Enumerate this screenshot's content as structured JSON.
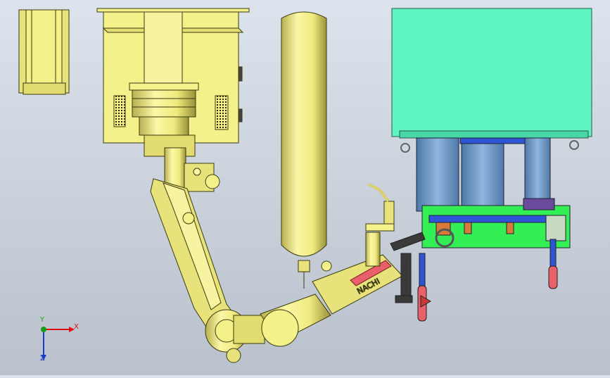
{
  "viewport": {
    "background_top": "#dde3ec",
    "background_bottom": "#b9c1cc"
  },
  "model": {
    "colors": {
      "robot_body": "#f4f08a",
      "robot_edge": "#3a3a10",
      "fixture_block": "#5ff5c0",
      "fixture_base": "#33ee55",
      "column": "#6e9bc9",
      "clamp_red": "#e8606a",
      "clamp_blue": "#2f55d6",
      "dark_part": "#3a3a3a",
      "pink_sensor": "#ff6a8a"
    },
    "robot_label_text": "NACHI"
  },
  "triad": {
    "x_label": "X",
    "y_label": "Y",
    "z_label": "Z",
    "x_color": "#dd1111",
    "y_color": "#1a9a1a",
    "z_color": "#1a3cc8"
  }
}
